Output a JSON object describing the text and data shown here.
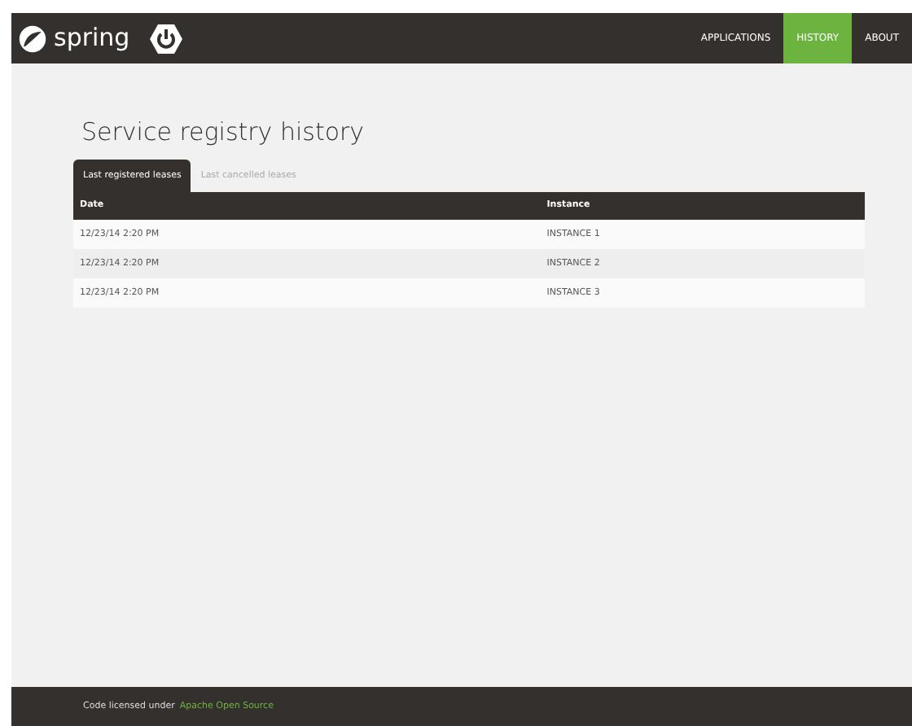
{
  "navbar": {
    "brand": "spring",
    "links": [
      {
        "label": "APPLICATIONS",
        "selected": false
      },
      {
        "label": "HISTORY",
        "selected": true
      },
      {
        "label": "ABOUT",
        "selected": false
      }
    ]
  },
  "title": "Service registry history",
  "tabs": [
    {
      "label": "Last registered leases",
      "selected": true
    },
    {
      "label": "Last cancelled leases",
      "selected": false
    }
  ],
  "table": {
    "columns": [
      "Date",
      "Instance"
    ],
    "rows": [
      [
        "12/23/14 2:20 PM",
        "INSTANCE 1"
      ],
      [
        "12/23/14 2:20 PM",
        "INSTANCE 2"
      ],
      [
        "12/23/14 2:20 PM",
        "INSTANCE 3"
      ]
    ]
  },
  "footer": {
    "text": "Code licensed under",
    "link": "Apache Open Source"
  }
}
